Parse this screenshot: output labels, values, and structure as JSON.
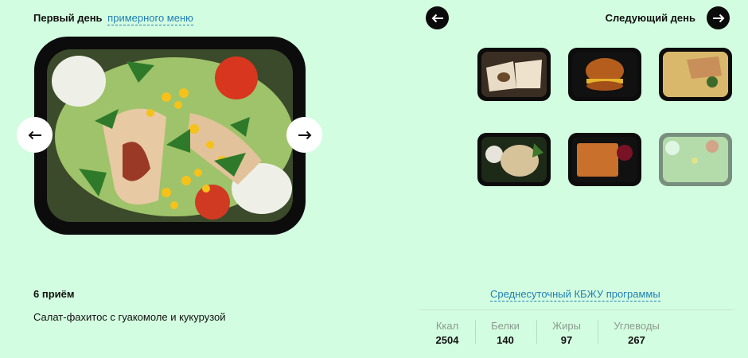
{
  "header": {
    "day_label": "Первый день",
    "menu_link": "примерного меню",
    "next_day_label": "Следующий день"
  },
  "icons": {
    "prev_day": "arrow-left-icon",
    "next_day": "arrow-right-icon",
    "gallery_prev": "arrow-left-icon",
    "gallery_next": "arrow-right-icon"
  },
  "meal": {
    "number_label": "6 приём",
    "name": "Салат-фахитос с гуакомоле и кукурузой"
  },
  "thumbnails": [
    {
      "dish": "wrap"
    },
    {
      "dish": "burger"
    },
    {
      "dish": "couscous-chicken"
    },
    {
      "dish": "porridge-salad"
    },
    {
      "dish": "casserole-jam"
    },
    {
      "dish": "fajitas-salad",
      "active": true
    }
  ],
  "nutrition": {
    "title": "Среднесуточный КБЖУ программы",
    "items": [
      {
        "label": "Ккал",
        "value": "2504"
      },
      {
        "label": "Белки",
        "value": "140"
      },
      {
        "label": "Жиры",
        "value": "97"
      },
      {
        "label": "Углеводы",
        "value": "267"
      }
    ]
  },
  "colors": {
    "background": "#d3fde0",
    "link": "#1f7fb6",
    "button_dark": "#0b0b0b",
    "muted_label": "#8c9a90"
  }
}
